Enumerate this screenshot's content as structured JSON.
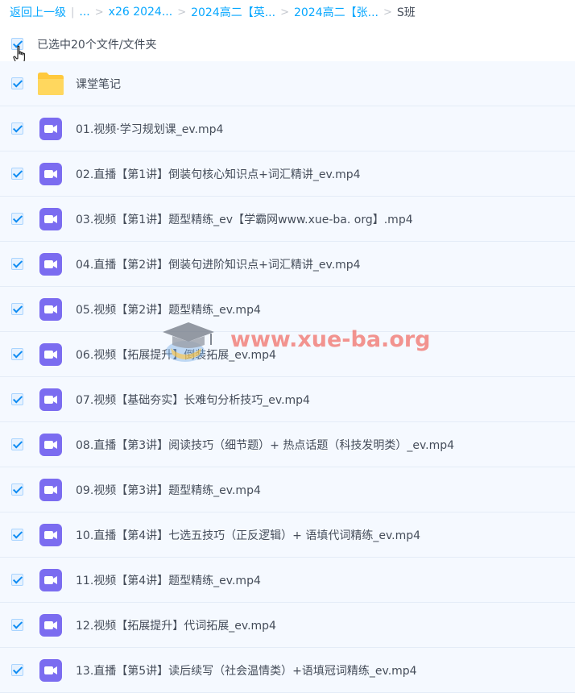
{
  "breadcrumb": {
    "back": "返回上一级",
    "divider": "|",
    "ellipsis": "...",
    "sep": ">",
    "crumbs": [
      "x26 2024...",
      "2024高二【英...",
      "2024高二【张...",
      "S班"
    ]
  },
  "selection": {
    "label": "已选中20个文件/文件夹"
  },
  "files": [
    {
      "name": "课堂笔记",
      "type": "folder",
      "icon": "folder-icon"
    },
    {
      "name": "01.视频·学习规划课_ev.mp4",
      "type": "video",
      "icon": "video-icon"
    },
    {
      "name": "02.直播【第1讲】倒装句核心知识点+词汇精讲_ev.mp4",
      "type": "video",
      "icon": "video-icon"
    },
    {
      "name": "03.视频【第1讲】题型精练_ev【学霸网www.xue-ba. org】.mp4",
      "type": "video",
      "icon": "video-icon"
    },
    {
      "name": "04.直播【第2讲】倒装句进阶知识点+词汇精讲_ev.mp4",
      "type": "video",
      "icon": "video-icon"
    },
    {
      "name": "05.视频【第2讲】题型精练_ev.mp4",
      "type": "video",
      "icon": "video-icon"
    },
    {
      "name": "06.视频【拓展提升】倒装拓展_ev.mp4",
      "type": "video",
      "icon": "video-icon"
    },
    {
      "name": "07.视频【基础夯实】长难句分析技巧_ev.mp4",
      "type": "video",
      "icon": "video-icon"
    },
    {
      "name": "08.直播【第3讲】阅读技巧（细节题）+ 热点话题（科技发明类）_ev.mp4",
      "type": "video",
      "icon": "video-icon"
    },
    {
      "name": "09.视频【第3讲】题型精练_ev.mp4",
      "type": "video",
      "icon": "video-icon"
    },
    {
      "name": "10.直播【第4讲】七选五技巧（正反逻辑）+ 语填代词精练_ev.mp4",
      "type": "video",
      "icon": "video-icon"
    },
    {
      "name": "11.视频【第4讲】题型精练_ev.mp4",
      "type": "video",
      "icon": "video-icon"
    },
    {
      "name": "12.视频【拓展提升】代词拓展_ev.mp4",
      "type": "video",
      "icon": "video-icon"
    },
    {
      "name": "13.直播【第5讲】读后续写（社会温情类）+语填冠词精练_ev.mp4",
      "type": "video",
      "icon": "video-icon"
    }
  ],
  "watermark": {
    "text": "www.xue-ba.org"
  },
  "colors": {
    "link": "#06a7ff",
    "row_bg": "#f5f9ff",
    "checkbox_tick": "#0d8bf2",
    "video_icon": "#7b6cf0",
    "folder_icon": "#ffc93d",
    "watermark": "#f05a50"
  }
}
